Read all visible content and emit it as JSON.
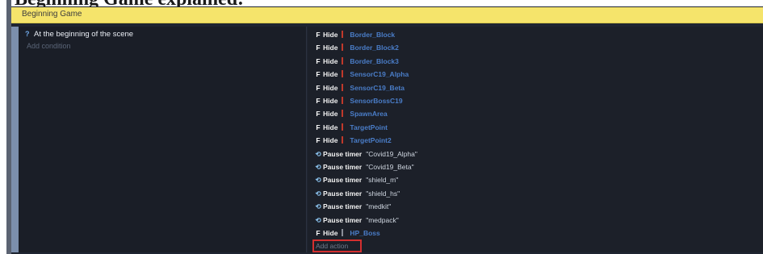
{
  "heading": "Beginning Game explained:",
  "group": {
    "label": "Beginning Game"
  },
  "event": {
    "condition": "At the beginning of the scene",
    "add_condition": "Add condition",
    "add_action": "Add action"
  },
  "actions": [
    {
      "icon": "hide-icon",
      "glyph": "F",
      "verb": "Hide",
      "marker_color": "#c0392b",
      "target": "Border_Block",
      "is_string": false
    },
    {
      "icon": "hide-icon",
      "glyph": "F",
      "verb": "Hide",
      "marker_color": "#c0392b",
      "target": "Border_Block2",
      "is_string": false
    },
    {
      "icon": "hide-icon",
      "glyph": "F",
      "verb": "Hide",
      "marker_color": "#c0392b",
      "target": "Border_Block3",
      "is_string": false
    },
    {
      "icon": "hide-icon",
      "glyph": "F",
      "verb": "Hide",
      "marker_color": "#c0392b",
      "target": "SensorC19_Alpha",
      "is_string": false
    },
    {
      "icon": "hide-icon",
      "glyph": "F",
      "verb": "Hide",
      "marker_color": "#c0392b",
      "target": "SensorC19_Beta",
      "is_string": false
    },
    {
      "icon": "hide-icon",
      "glyph": "F",
      "verb": "Hide",
      "marker_color": "#c0392b",
      "target": "SensorBossC19",
      "is_string": false
    },
    {
      "icon": "hide-icon",
      "glyph": "F",
      "verb": "Hide",
      "marker_color": "#c0392b",
      "target": "SpawnArea",
      "is_string": false
    },
    {
      "icon": "hide-icon",
      "glyph": "F",
      "verb": "Hide",
      "marker_color": "#c0392b",
      "target": "TargetPoint",
      "is_string": false
    },
    {
      "icon": "hide-icon",
      "glyph": "F",
      "verb": "Hide",
      "marker_color": "#c0392b",
      "target": "TargetPoint2",
      "is_string": false
    },
    {
      "icon": "timer-icon",
      "glyph": "⟲",
      "verb": "Pause timer",
      "marker_color": "",
      "target": "\"Covid19_Alpha\"",
      "is_string": true
    },
    {
      "icon": "timer-icon",
      "glyph": "⟲",
      "verb": "Pause timer",
      "marker_color": "",
      "target": "\"Covid19_Beta\"",
      "is_string": true
    },
    {
      "icon": "timer-icon",
      "glyph": "⟲",
      "verb": "Pause timer",
      "marker_color": "",
      "target": "\"shield_m\"",
      "is_string": true
    },
    {
      "icon": "timer-icon",
      "glyph": "⟲",
      "verb": "Pause timer",
      "marker_color": "",
      "target": "\"shield_hs\"",
      "is_string": true
    },
    {
      "icon": "timer-icon",
      "glyph": "⟲",
      "verb": "Pause timer",
      "marker_color": "",
      "target": "\"medkit\"",
      "is_string": true
    },
    {
      "icon": "timer-icon",
      "glyph": "⟲",
      "verb": "Pause timer",
      "marker_color": "",
      "target": "\"medpack\"",
      "is_string": true
    },
    {
      "icon": "hide-icon",
      "glyph": "F",
      "verb": "Hide",
      "marker_color": "#8a8f99",
      "target": "HP_Boss",
      "is_string": false
    }
  ],
  "colors": {
    "group_bar": "#f5e46b",
    "object_name": "#4a7dc8",
    "add_action_highlight": "#d32f2f"
  }
}
